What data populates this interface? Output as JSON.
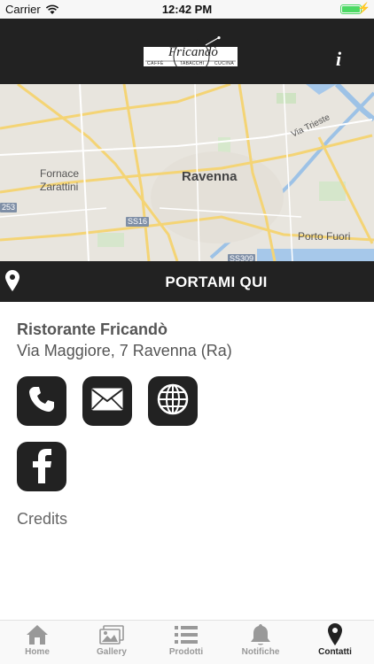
{
  "status_bar": {
    "carrier": "Carrier",
    "time": "12:42 PM",
    "battery_level": 1.0
  },
  "header": {
    "logo": {
      "name": "Fricandò",
      "left_word": "CAFFÈ",
      "middle_word": "TABACCHI",
      "right_word": "CUCINA"
    },
    "info_icon": "info-icon"
  },
  "map": {
    "labels": {
      "city": "Ravenna",
      "fornace_line1": "Fornace",
      "fornace_line2": "Zarattini",
      "porto_fuori": "Porto Fuori",
      "via_trieste": "Via Trieste"
    },
    "road_shields": {
      "ss16": "SS16",
      "ss309": "SS309",
      "r253": "253"
    }
  },
  "directions": {
    "label": "PORTAMI QUI",
    "icon": "map-pin-icon"
  },
  "contact": {
    "name": "Ristorante Fricandò",
    "address": "Via Maggiore, 7 Ravenna (Ra)",
    "buttons": [
      {
        "icon": "phone-icon"
      },
      {
        "icon": "mail-icon"
      },
      {
        "icon": "globe-icon"
      },
      {
        "icon": "facebook-icon"
      }
    ],
    "credits": "Credits"
  },
  "tab_bar": {
    "tabs": [
      {
        "label": "Home",
        "icon": "home-icon",
        "active": false
      },
      {
        "label": "Gallery",
        "icon": "gallery-icon",
        "active": false
      },
      {
        "label": "Prodotti",
        "icon": "list-icon",
        "active": false
      },
      {
        "label": "Notifiche",
        "icon": "bell-icon",
        "active": false
      },
      {
        "label": "Contatti",
        "icon": "map-pin-icon",
        "active": true
      }
    ]
  },
  "colors": {
    "dark": "#222222",
    "accent_green": "#4cd964",
    "text_gray": "#555555",
    "tab_inactive": "#999999"
  }
}
